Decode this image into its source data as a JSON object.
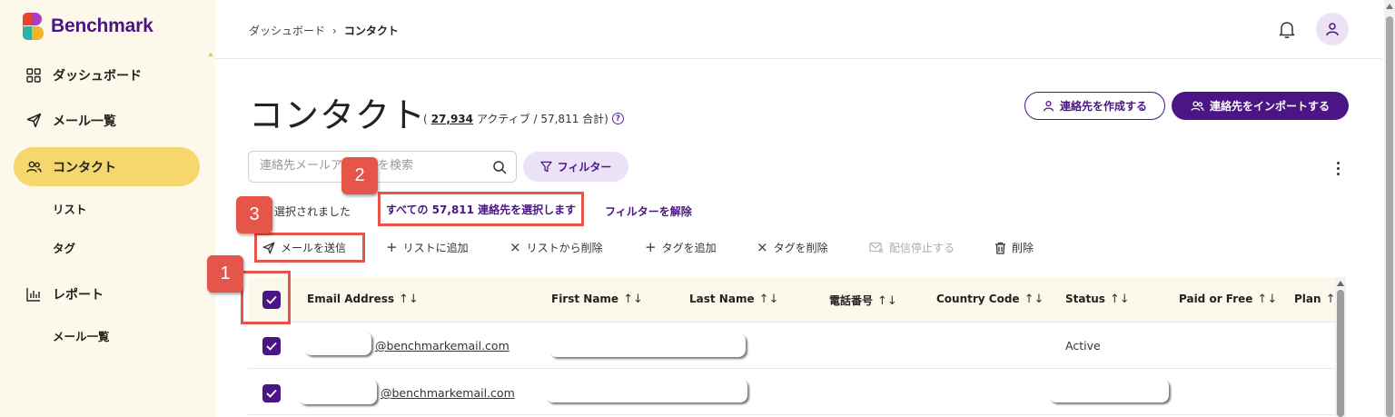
{
  "brand": {
    "name": "Benchmark"
  },
  "sidebar": {
    "items": [
      {
        "label": "ダッシュボード",
        "icon": "grid-icon"
      },
      {
        "label": "メール一覧",
        "icon": "send-icon"
      },
      {
        "label": "コンタクト",
        "icon": "users-icon",
        "active": true
      },
      {
        "label": "リスト",
        "sub": true
      },
      {
        "label": "タグ",
        "sub": true
      },
      {
        "label": "レポート",
        "icon": "bar-chart-icon"
      },
      {
        "label": "メール一覧",
        "sub": true
      }
    ]
  },
  "header": {
    "breadcrumb": [
      "ダッシュボード",
      "›",
      "コンタクト"
    ]
  },
  "page": {
    "title": "コンタクト",
    "active_count": "27,934",
    "meta_rest": "アクティブ / 57,811 合計)",
    "meta_open": "(",
    "create_button": "連絡先を作成する",
    "import_button": "連絡先をインポートする"
  },
  "search": {
    "placeholder": "連絡先メールアドレスを検索"
  },
  "filter": {
    "label": "フィルター"
  },
  "selection": {
    "selected_text": "選択されました",
    "select_all": "すべての 57,811 連絡先を選択します",
    "clear_filter": "フィルターを解除"
  },
  "actions": {
    "send": "メールを送信",
    "add_to_list": "リストに追加",
    "remove_from_list": "リストから削除",
    "add_tag": "タグを追加",
    "remove_tag": "タグを削除",
    "unsubscribe": "配信停止する",
    "delete": "削除"
  },
  "table": {
    "columns": [
      "Email Address",
      "First Name",
      "Last Name",
      "電話番号",
      "Country Code",
      "Status",
      "Paid or Free",
      "Plan"
    ],
    "rows": [
      {
        "email": "@benchmarkemail.com",
        "status": "Active"
      },
      {
        "email": "@benchmarkemail.com",
        "status": ""
      }
    ]
  },
  "annotations": [
    "1",
    "2",
    "3"
  ],
  "colors": {
    "brand": "#4b1585",
    "highlight": "#e5554a",
    "sidebar_bg": "#fdf9ea",
    "active_nav": "#f5d76e"
  }
}
